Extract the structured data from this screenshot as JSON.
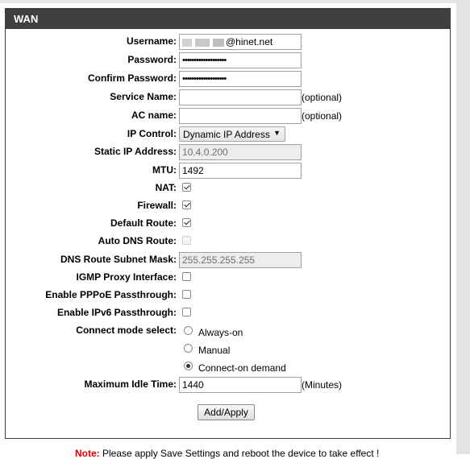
{
  "panel": {
    "title": "WAN"
  },
  "fields": {
    "username": {
      "label": "Username:",
      "value_suffix": "@hinet.net"
    },
    "password": {
      "label": "Password:",
      "value": "•••••••••••••••••••"
    },
    "confirm_password": {
      "label": "Confirm Password:",
      "value": "•••••••••••••••••••"
    },
    "service_name": {
      "label": "Service Name:",
      "value": "",
      "suffix": "(optional)"
    },
    "ac_name": {
      "label": "AC name:",
      "value": "",
      "suffix": "(optional)"
    },
    "ip_control": {
      "label": "IP Control:",
      "selected": "Dynamic IP Address"
    },
    "static_ip": {
      "label": "Static IP Address:",
      "value": "10.4.0.200"
    },
    "mtu": {
      "label": "MTU:",
      "value": "1492"
    },
    "nat": {
      "label": "NAT:",
      "checked": true
    },
    "firewall": {
      "label": "Firewall:",
      "checked": true
    },
    "default_route": {
      "label": "Default Route:",
      "checked": true
    },
    "auto_dns_route": {
      "label": "Auto DNS Route:",
      "checked": false,
      "disabled": true
    },
    "dns_route_mask": {
      "label": "DNS Route Subnet Mask:",
      "value": "255.255.255.255"
    },
    "igmp_proxy": {
      "label": "IGMP Proxy Interface:",
      "checked": false
    },
    "pppoe_passthrough": {
      "label": "Enable PPPoE Passthrough:",
      "checked": false
    },
    "ipv6_passthrough": {
      "label": "Enable IPv6 Passthrough:",
      "checked": false
    },
    "connect_mode": {
      "label": "Connect mode select:",
      "options": [
        "Always-on",
        "Manual",
        "Connect-on demand"
      ],
      "selected": "Connect-on demand"
    },
    "max_idle": {
      "label": "Maximum Idle Time:",
      "value": "1440",
      "suffix": "(Minutes)"
    }
  },
  "actions": {
    "apply_label": "Add/Apply"
  },
  "note": {
    "label": "Note:",
    "text": " Please apply Save Settings and reboot the device to take effect !"
  }
}
